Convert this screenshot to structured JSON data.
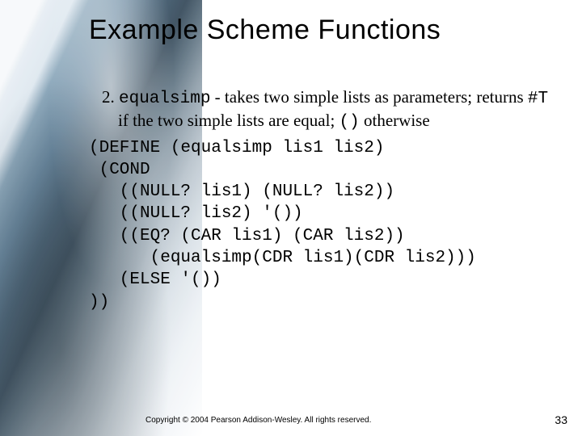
{
  "title": "Example Scheme Functions",
  "item_number": "2.",
  "func_name": "equalsimp",
  "desc_part1": " - takes two simple lists as parameters; returns ",
  "true_token": "#T",
  "desc_part2": " if the two simple lists are equal; ",
  "empty_token": "()",
  "desc_part3": " otherwise",
  "code_lines": {
    "l1": "(DEFINE (equalsimp lis1 lis2)",
    "l2": " (COND",
    "l3": "   ((NULL? lis1) (NULL? lis2))",
    "l4": "   ((NULL? lis2) '())",
    "l5": "   ((EQ? (CAR lis1) (CAR lis2))",
    "l6": "      (equalsimp(CDR lis1)(CDR lis2)))",
    "l7": "   (ELSE '())",
    "l8": "))"
  },
  "footer": "Copyright © 2004 Pearson Addison-Wesley. All rights reserved.",
  "page_number": "33"
}
